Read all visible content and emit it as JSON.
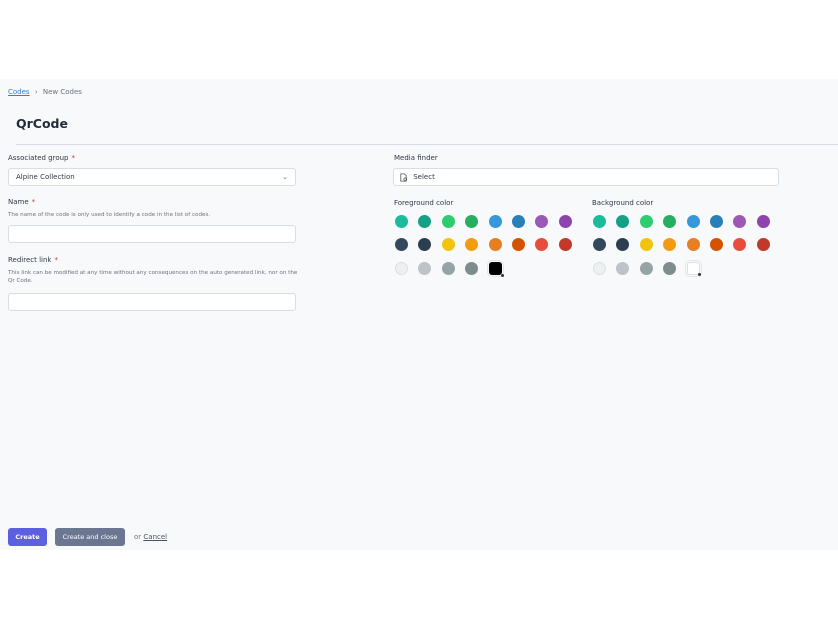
{
  "breadcrumb": {
    "link": "Codes",
    "sep": "›",
    "current": "New Codes"
  },
  "page_title": "QrCode",
  "associated_group": {
    "label": "Associated group",
    "required": "*",
    "value": "Alpine Collection"
  },
  "name": {
    "label": "Name",
    "required": "*",
    "help": "The name of the code is only used to identify a code in the list of codes.",
    "value": ""
  },
  "redirect": {
    "label": "Redirect link",
    "required": "*",
    "help": "This link can be modified at any time without any consequences on the auto generated link, nor on the Qr Code.",
    "value": ""
  },
  "media_finder": {
    "label": "Media finder",
    "placeholder": "Select"
  },
  "foreground": {
    "label": "Foreground color",
    "selected": "#000000"
  },
  "background": {
    "label": "Background color",
    "selected": "#ffffff"
  },
  "palette": [
    "#1abc9c",
    "#16a085",
    "#2ecc71",
    "#27ae60",
    "#3498db",
    "#2980b9",
    "#9b59b6",
    "#8e44ad",
    "#34495e",
    "#2c3e50",
    "#f1c40f",
    "#f39c12",
    "#e67e22",
    "#d35400",
    "#e74c3c",
    "#c0392b",
    "#ecf0f1",
    "#bdc3c7",
    "#95a5a6",
    "#7f8c8d"
  ],
  "actions": {
    "create": "Create",
    "create_close": "Create and close",
    "or": "or",
    "cancel": "Cancel"
  }
}
